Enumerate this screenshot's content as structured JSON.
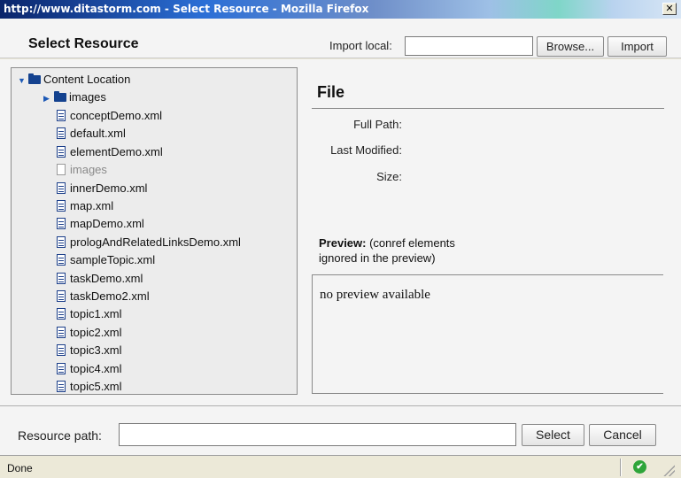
{
  "window": {
    "url": "http://www.ditastorm.com - ",
    "dialog_title": "Select Resource",
    "app": " - Mozilla Firefox",
    "close_symbol": "✕"
  },
  "header": {
    "title": "Select Resource",
    "import_label": "Import local:",
    "import_value": "",
    "browse_label": "Browse...",
    "import_button": "Import"
  },
  "tree": {
    "root": "Content Location",
    "items": [
      {
        "label": "images",
        "kind": "folder"
      },
      {
        "label": "conceptDemo.xml",
        "kind": "file"
      },
      {
        "label": "default.xml",
        "kind": "file"
      },
      {
        "label": "elementDemo.xml",
        "kind": "file"
      },
      {
        "label": "images",
        "kind": "blank"
      },
      {
        "label": "innerDemo.xml",
        "kind": "file"
      },
      {
        "label": "map.xml",
        "kind": "file"
      },
      {
        "label": "mapDemo.xml",
        "kind": "file"
      },
      {
        "label": "prologAndRelatedLinksDemo.xml",
        "kind": "file"
      },
      {
        "label": "sampleTopic.xml",
        "kind": "file"
      },
      {
        "label": "taskDemo.xml",
        "kind": "file"
      },
      {
        "label": "taskDemo2.xml",
        "kind": "file"
      },
      {
        "label": "topic1.xml",
        "kind": "file"
      },
      {
        "label": "topic2.xml",
        "kind": "file"
      },
      {
        "label": "topic3.xml",
        "kind": "file"
      },
      {
        "label": "topic4.xml",
        "kind": "file"
      },
      {
        "label": "topic5.xml",
        "kind": "file"
      }
    ]
  },
  "details": {
    "heading": "File",
    "full_path_label": "Full Path:",
    "last_modified_label": "Last Modified:",
    "size_label": "Size:",
    "preview_title": "Preview:",
    "preview_note": " (conref elements ignored in the preview)",
    "preview_empty": "no preview available"
  },
  "footer": {
    "resource_path_label": "Resource path:",
    "resource_path_value": "",
    "select_label": "Select",
    "cancel_label": "Cancel"
  },
  "status": {
    "text": "Done",
    "ok_symbol": "✔"
  },
  "colors": {
    "title_bar_start": "#0a246a",
    "folder_icon": "#14428f",
    "status_ok": "#2ea53a"
  }
}
